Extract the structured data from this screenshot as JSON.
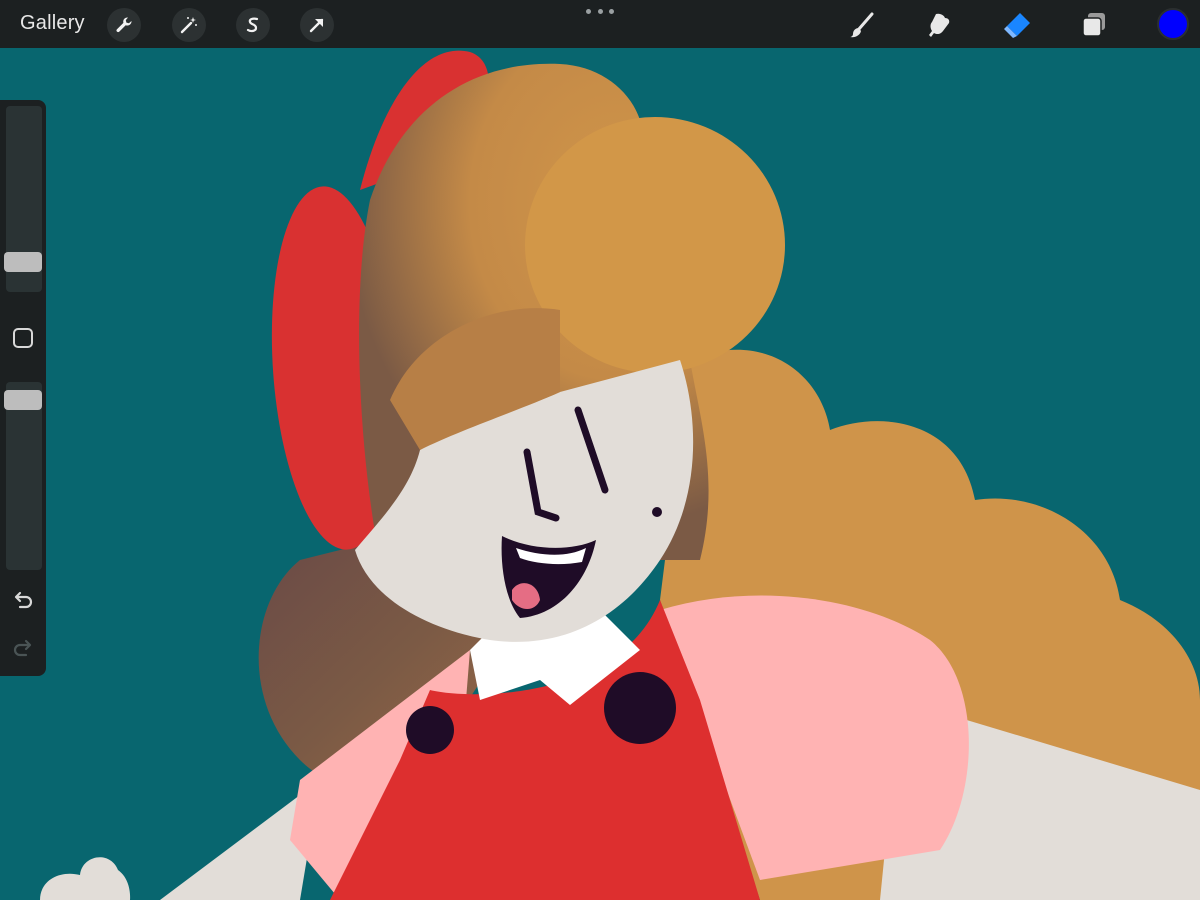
{
  "toolbar": {
    "gallery_label": "Gallery",
    "left_tools": [
      "wrench-icon",
      "magic-wand-icon",
      "selection-s-icon",
      "transform-arrow-icon"
    ],
    "right_tools": [
      "brush-icon",
      "smudge-icon",
      "eraser-icon",
      "layers-icon"
    ],
    "active_tool": "eraser-icon",
    "current_color": "#0000ff"
  },
  "sidebar": {
    "brush_size_fraction": 0.12,
    "brush_opacity_fraction": 0.95,
    "controls": [
      "brush-size-slider",
      "modify-button",
      "opacity-slider",
      "undo-icon",
      "redo-icon"
    ]
  },
  "colors": {
    "background": "#08666f",
    "toolbar": "#1c2021",
    "active_accent": "#1a86ff",
    "skin": "#e2ddd8",
    "hair_light": "#d0954a",
    "hair_dark": "#7b5a45",
    "bow": "#d93131",
    "dress": "#dd2f2f",
    "sleeve": "#ffb3b3",
    "buttons": "#1f0c27"
  }
}
